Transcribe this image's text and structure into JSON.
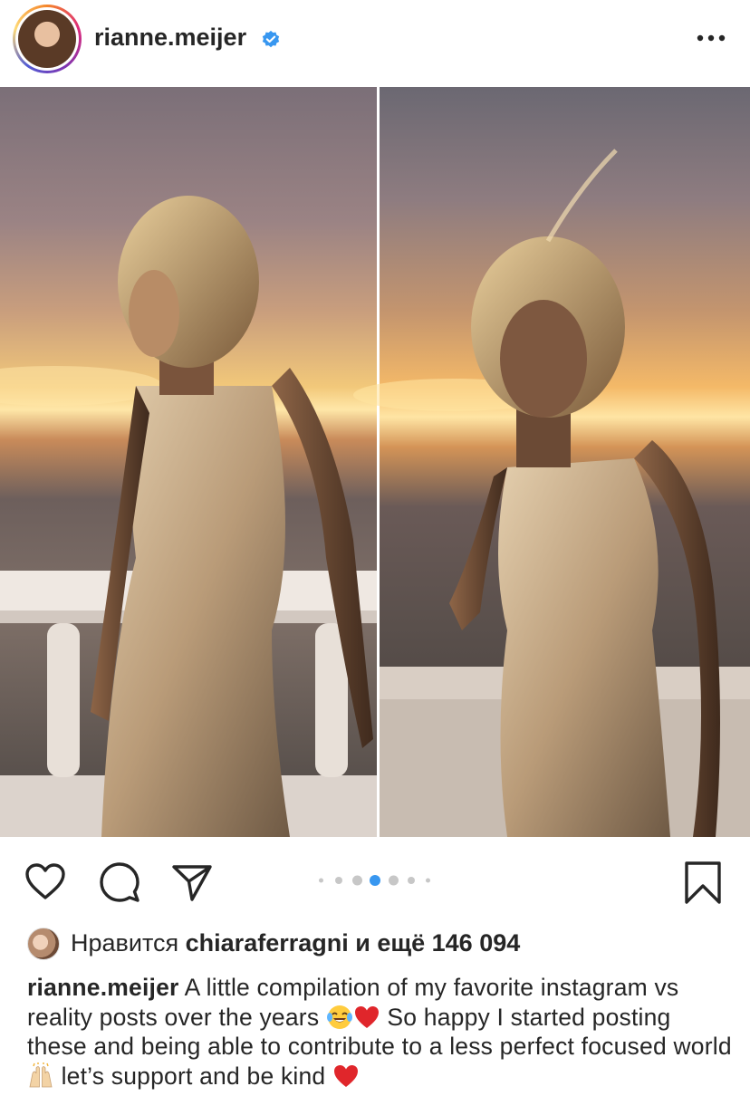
{
  "header": {
    "username": "rianne.meijer",
    "verified_icon": "verified-badge-icon",
    "more_icon": "more-options-icon"
  },
  "post": {
    "carousel": {
      "total": 7,
      "active_index": 3
    },
    "actions": {
      "like_icon": "heart-icon",
      "comment_icon": "comment-icon",
      "share_icon": "send-icon",
      "save_icon": "bookmark-icon"
    }
  },
  "likes": {
    "prefix": "Нравится ",
    "user": "chiaraferragni",
    "suffix": " и ещё 146 094"
  },
  "caption": {
    "user": "rianne.meijer",
    "part1": " A little compilation of my favorite instagram vs reality posts over the years ",
    "part2": " So happy I started posting these and being able to contribute to a less perfect focused world ",
    "part3": " let’s support and be kind "
  },
  "colors": {
    "accent_blue": "#3897f0",
    "text": "#262626",
    "dot_inactive": "#c7c7c7"
  }
}
